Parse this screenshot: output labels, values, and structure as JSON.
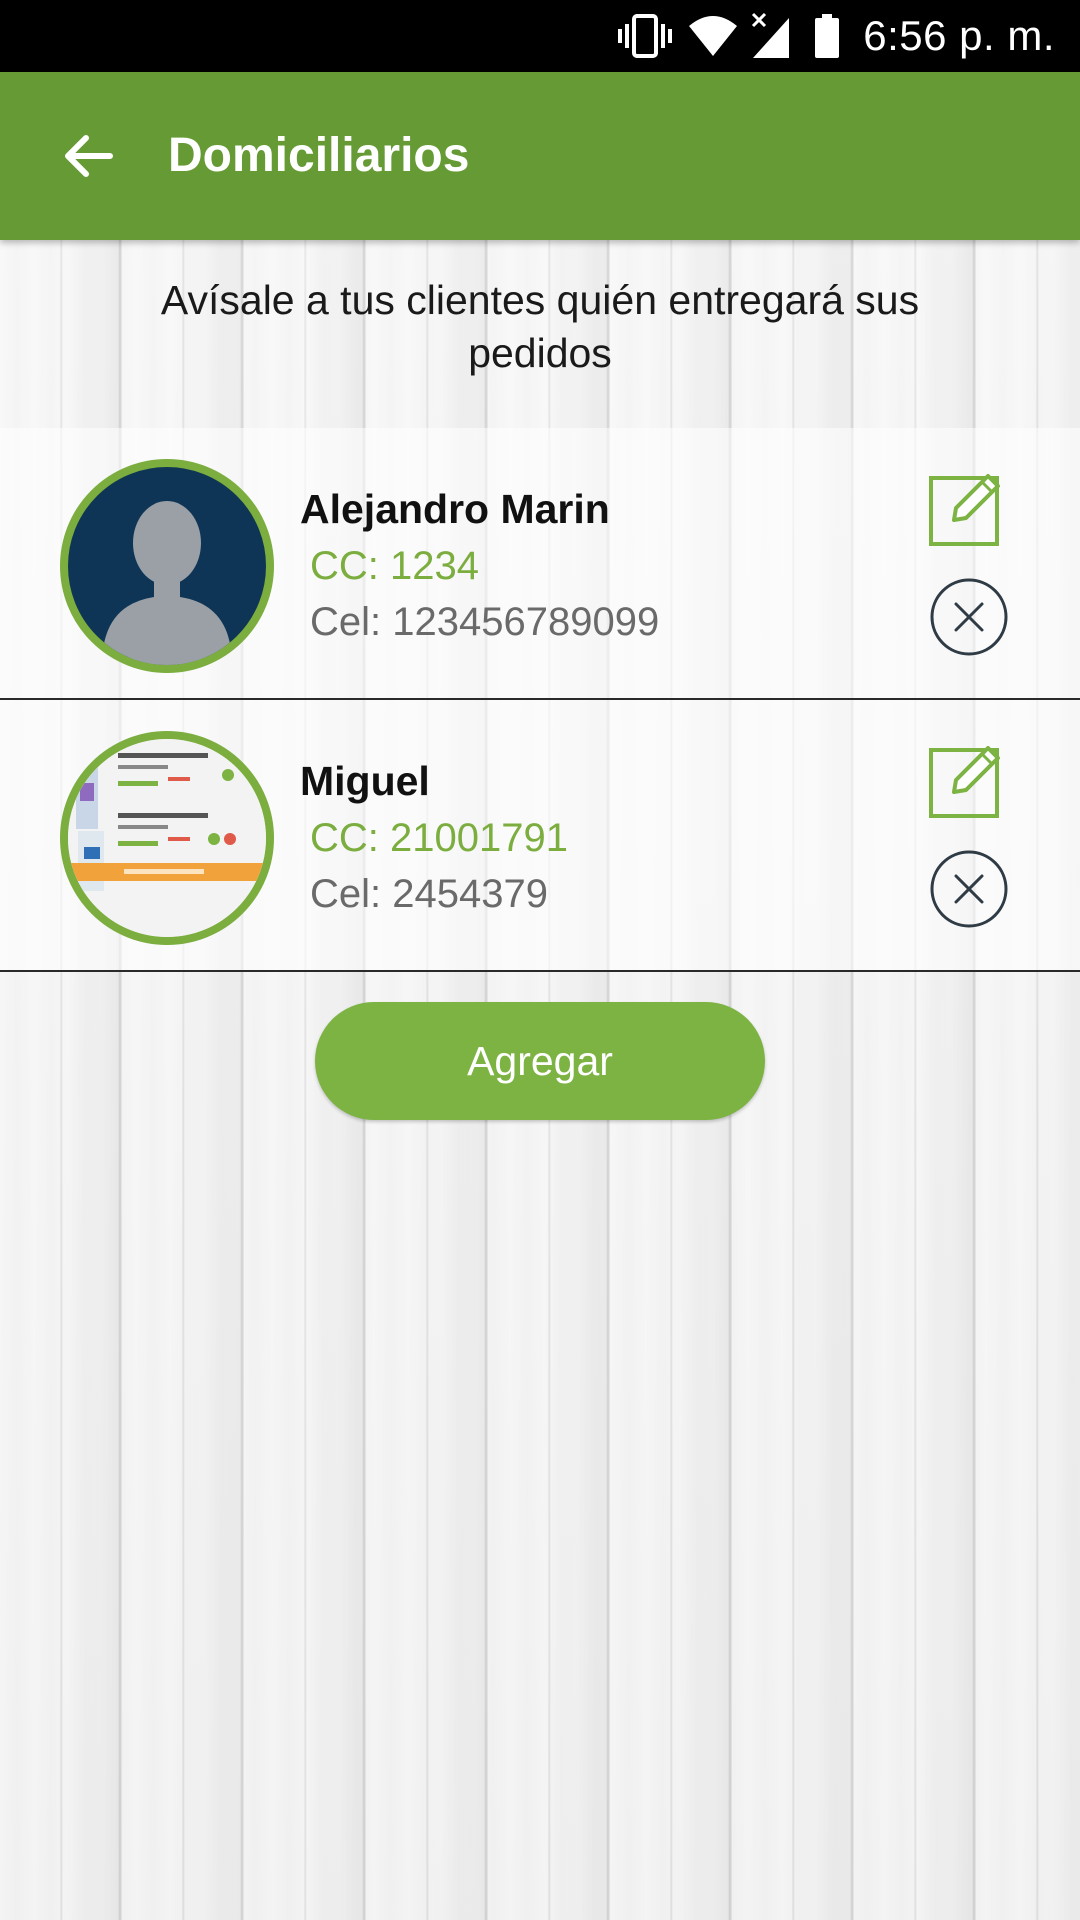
{
  "status_bar": {
    "time": "6:56 p. m.",
    "icons": [
      "vibrate-icon",
      "wifi-icon",
      "signal-no-service-icon",
      "battery-icon"
    ]
  },
  "app_bar": {
    "title": "Domiciliarios",
    "back_icon": "arrow-back-icon"
  },
  "subtitle": "Avísale a tus clientes quién entregará sus pedidos",
  "couriers": [
    {
      "name": "Alejandro Marin",
      "cc": "CC: 1234",
      "cel": "Cel: 123456789099",
      "avatar": "default-person-avatar"
    },
    {
      "name": "Miguel",
      "cc": "CC: 21001791",
      "cel": "Cel: 2454379",
      "avatar": "photo-avatar"
    }
  ],
  "add_button_label": "Agregar",
  "colors": {
    "app_bar": "#669a35",
    "accent_green": "#7cb342",
    "avatar_bg": "#0f3556",
    "secondary_text": "#6a6a6a"
  }
}
